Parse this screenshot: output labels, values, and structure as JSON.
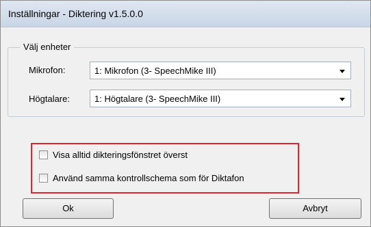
{
  "window": {
    "title": "Inställningar - Diktering v1.5.0.0"
  },
  "devices": {
    "group_label": "Välj enheter",
    "microphone": {
      "label": "Mikrofon:",
      "value": "1: Mikrofon (3- SpeechMike III)"
    },
    "speaker": {
      "label": "Högtalare:",
      "value": "1: Högtalare (3- SpeechMike III)"
    }
  },
  "options": [
    {
      "label": "Visa alltid dikteringsfönstret överst",
      "checked": false
    },
    {
      "label": "Använd samma kontrollschema som för Diktafon",
      "checked": false
    }
  ],
  "buttons": {
    "ok": "Ok",
    "cancel": "Avbryt"
  },
  "colors": {
    "highlight": "#e0262b",
    "dialog_bg": "#f0f0f0",
    "titlebar": "#c9d6e6"
  }
}
